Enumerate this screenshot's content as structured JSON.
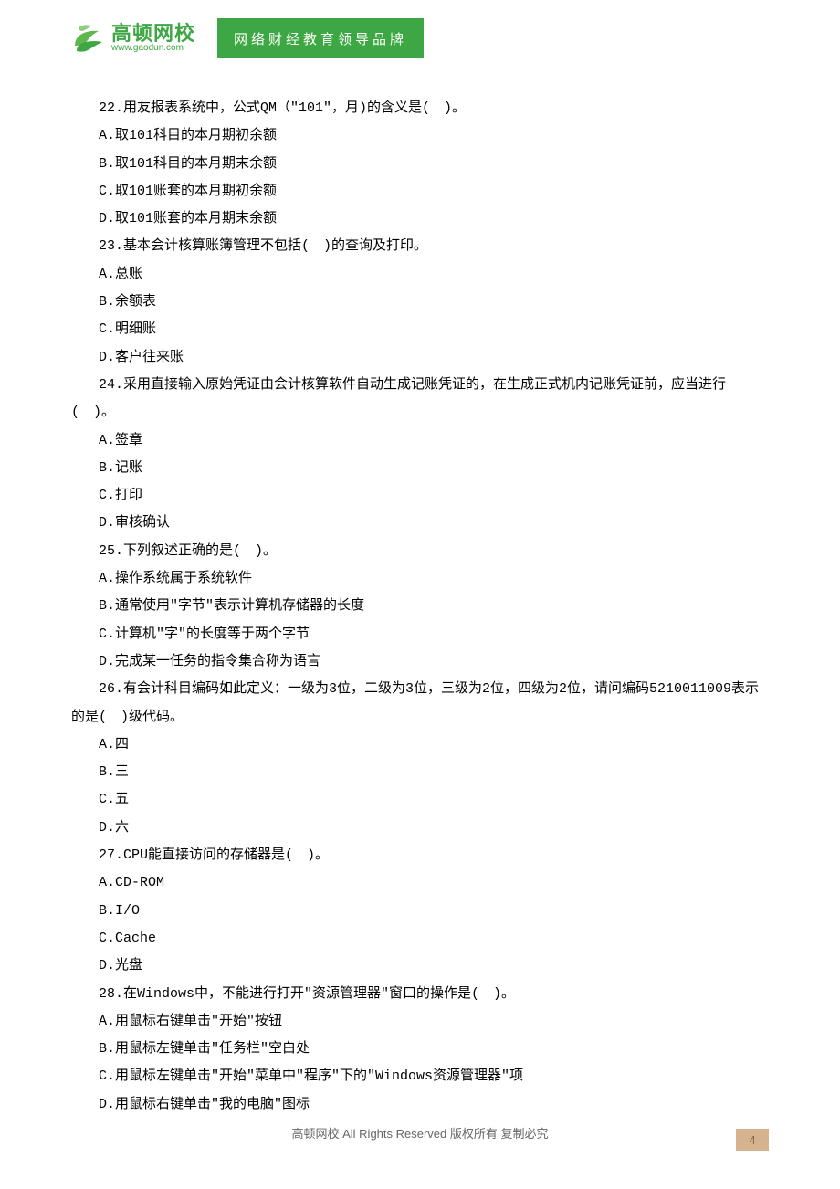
{
  "header": {
    "brand_cn": "高顿网校",
    "brand_en": "www.gaodun.com",
    "tagline": "网络财经教育领导品牌"
  },
  "questions": [
    {
      "stem": "22.用友报表系统中，公式QM（\"101\"，月)的含义是(　)。",
      "opts": [
        "A.取101科目的本月期初余额",
        "B.取101科目的本月期末余额",
        "C.取101账套的本月期初余额",
        "D.取101账套的本月期末余额"
      ]
    },
    {
      "stem": "23.基本会计核算账簿管理不包括(　)的查询及打印。",
      "opts": [
        "A.总账",
        "B.余额表",
        "C.明细账",
        "D.客户往来账"
      ]
    },
    {
      "stem": "24.采用直接输入原始凭证由会计核算软件自动生成记账凭证的，在生成正式机内记账凭证前，应当进行(　)。",
      "hang": true,
      "opts": [
        "A.签章",
        "B.记账",
        "C.打印",
        "D.审核确认"
      ]
    },
    {
      "stem": "25.下列叙述正确的是(　)。",
      "opts": [
        "A.操作系统属于系统软件",
        "B.通常使用\"字节\"表示计算机存储器的长度",
        "C.计算机\"字\"的长度等于两个字节",
        "D.完成某一任务的指令集合称为语言"
      ]
    },
    {
      "stem": "26.有会计科目编码如此定义：一级为3位，二级为3位，三级为2位，四级为2位，请问编码5210011009表示的是(　)级代码。",
      "hang": true,
      "opts": [
        "A.四",
        "B.三",
        "C.五",
        "D.六"
      ]
    },
    {
      "stem": "27.CPU能直接访问的存储器是(　)。",
      "opts": [
        "A.CD-ROM",
        "B.I/O",
        "C.Cache",
        "D.光盘"
      ]
    },
    {
      "stem": "28.在Windows中，不能进行打开\"资源管理器\"窗口的操作是(　)。",
      "opts": [
        "A.用鼠标右键单击\"开始\"按钮",
        "B.用鼠标左键单击\"任务栏\"空白处",
        "C.用鼠标左键单击\"开始\"菜单中\"程序\"下的\"Windows资源管理器\"项",
        "D.用鼠标右键单击\"我的电脑\"图标"
      ]
    }
  ],
  "footer": {
    "left": "高顿网校",
    "arr": " All Rights Reserved  ",
    "right": "版权所有 复制必究"
  },
  "page_number": "4"
}
